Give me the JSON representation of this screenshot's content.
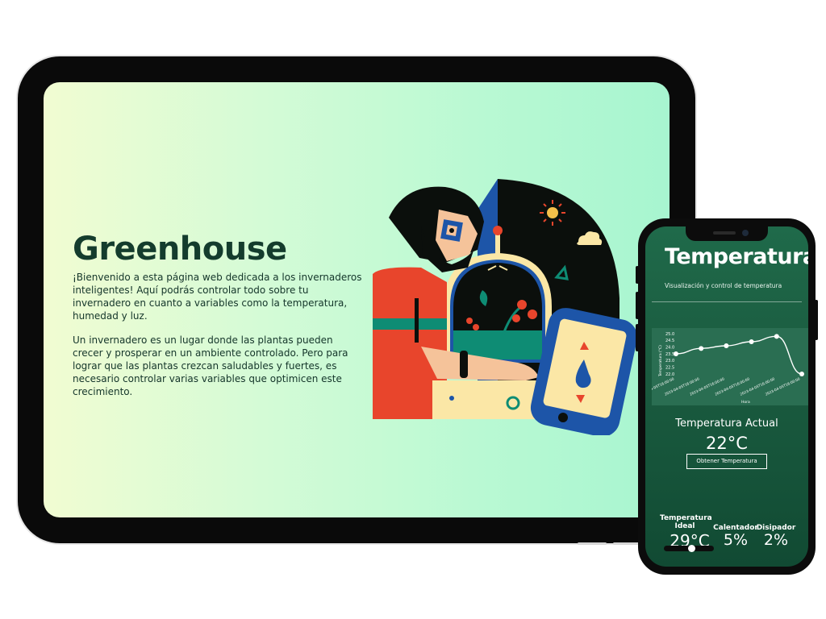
{
  "tablet": {
    "title": "Greenhouse",
    "paragraphs": [
      "¡Bienvenido a esta página web dedicada a los invernaderos inteligentes! Aquí podrás controlar todo sobre tu invernadero en cuanto a variables como la temperatura, humedad y luz.",
      "Un invernadero es un lugar donde las plantas pueden crecer y prosperar en un ambiente controlado. Pero para lograr que las plantas crezcan saludables y fuertes, es necesario controlar varias variables que optimicen este crecimiento."
    ]
  },
  "phone": {
    "title": "Temperatura",
    "subtitle": "Visualización y control de temperatura",
    "current_label": "Temperatura Actual",
    "current_value": "22°C",
    "button_label": "Obtener Temperatura",
    "ideal_label_line1": "Temperatura",
    "ideal_label_line2": "Ideal",
    "ideal_value": "29°C",
    "ideal_slider_fraction": 0.55,
    "heater_label": "Calentador",
    "heater_value": "5%",
    "fan_label": "Disipador",
    "fan_value": "2%"
  },
  "colors": {
    "phone_bg": "#1b5c40",
    "title_text": "#143c2d",
    "illus_red": "#e8452c",
    "illus_blue": "#1d55a8",
    "illus_cream": "#fbe7a6",
    "illus_teal": "#0e8c74"
  },
  "chart_data": {
    "type": "line",
    "ylabel": "Temperatura (°C)",
    "xlabel": "Hora",
    "ylim": [
      22.0,
      25.0
    ],
    "yticks": [
      "25.0",
      "24.5",
      "24.0",
      "23.5",
      "23.0",
      "22.5",
      "22.0"
    ],
    "categories": [
      "2023-04-05T16:00:00",
      "2023-04-05T16:00:00",
      "2023-04-05T16:00:00",
      "2023-04-05T16:00:00",
      "2023-04-05T16:00:00",
      "2023-04-05T16:00:00"
    ],
    "values": [
      23.5,
      23.9,
      24.1,
      24.4,
      24.8,
      22.0
    ]
  }
}
